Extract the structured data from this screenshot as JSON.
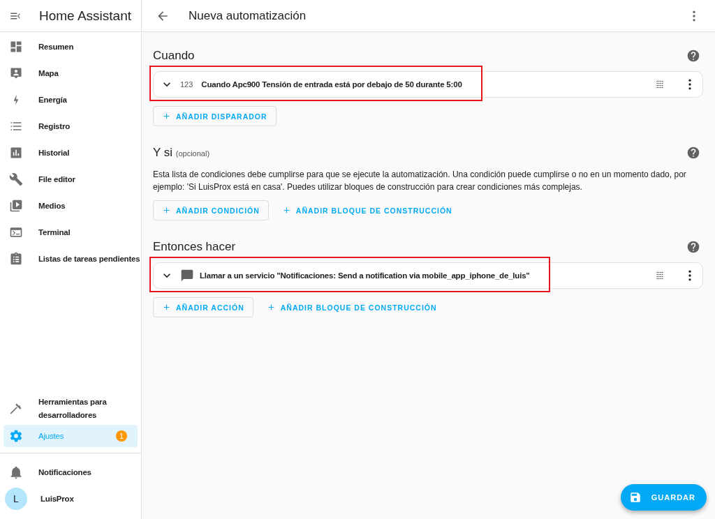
{
  "sidebar": {
    "title": "Home Assistant",
    "items": [
      {
        "label": "Resumen",
        "selected": false
      },
      {
        "label": "Mapa",
        "selected": false
      },
      {
        "label": "Energía",
        "selected": false
      },
      {
        "label": "Registro",
        "selected": false
      },
      {
        "label": "Historial",
        "selected": false
      },
      {
        "label": "File editor",
        "selected": false
      },
      {
        "label": "Medios",
        "selected": false
      },
      {
        "label": "Terminal",
        "selected": false
      },
      {
        "label": "Listas de tareas pendientes",
        "selected": false
      }
    ],
    "bottom_items": [
      {
        "label": "Herramientas para desarrolladores",
        "selected": false
      },
      {
        "label": "Ajustes",
        "selected": true,
        "badge": "1"
      }
    ],
    "notifications": "Notificaciones",
    "user": {
      "initial": "L",
      "name": "LuisProx"
    }
  },
  "header": {
    "title": "Nueva automatización"
  },
  "sections": [
    {
      "title": "Cuando",
      "rows": [
        {
          "kind": "numeric",
          "icon_text": "123",
          "text": "Cuando Apc900 Tensión de entrada está por debajo de 50 durante 5:00",
          "highlighted": true
        }
      ],
      "buttons": [
        {
          "label": "AÑADIR DISPARADOR",
          "kind": "outlined"
        }
      ]
    },
    {
      "title": "Y si",
      "note": "(opcional)",
      "description": "Esta lista de condiciones debe cumplirse para que se ejecute la automatización. Una condición puede cumplirse o no en un momento dado, por ejemplo: 'Si LuisProx está en casa'. Puedes utilizar bloques de construcción para crear condiciones más complejas.",
      "buttons": [
        {
          "label": "AÑADIR CONDICIÓN",
          "kind": "outlined"
        },
        {
          "label": "AÑADIR BLOQUE DE CONSTRUCCIÓN",
          "kind": "text"
        }
      ]
    },
    {
      "title": "Entonces hacer",
      "rows": [
        {
          "kind": "service",
          "text": "Llamar a un servicio \"Notificaciones: Send a notification via mobile_app_iphone_de_luis\"",
          "highlighted": true
        }
      ],
      "buttons": [
        {
          "label": "AÑADIR ACCIÓN",
          "kind": "outlined"
        },
        {
          "label": "AÑADIR BLOQUE DE CONSTRUCCIÓN",
          "kind": "text"
        }
      ]
    }
  ],
  "fab": {
    "label": "GUARDAR"
  }
}
